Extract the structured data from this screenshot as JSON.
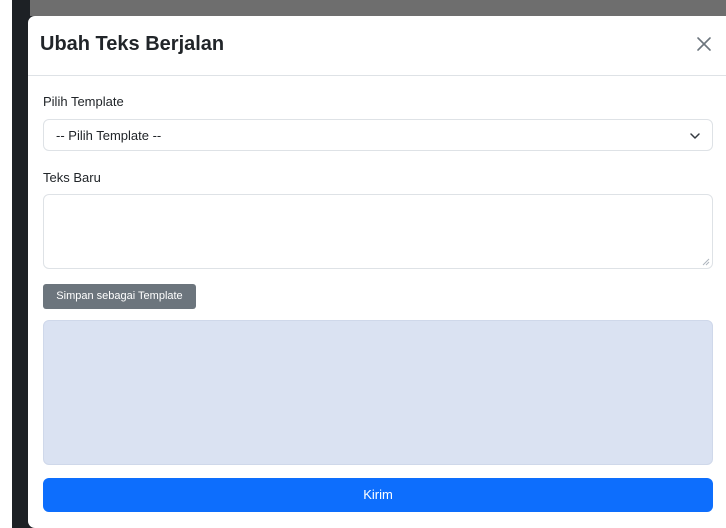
{
  "modal": {
    "title": "Ubah Teks Berjalan",
    "close_icon": "close-icon"
  },
  "template_select": {
    "label": "Pilih Template",
    "selected_value": "-- Pilih Template --",
    "icon": "chevron-down-icon"
  },
  "new_text": {
    "label": "Teks Baru",
    "value": ""
  },
  "buttons": {
    "save_template_label": "Simpan sebagai Template",
    "submit_label": "Kirim"
  },
  "colors": {
    "primary": "#0d6efd",
    "secondary": "#6c757d",
    "preview_bg": "#dae2f2"
  }
}
